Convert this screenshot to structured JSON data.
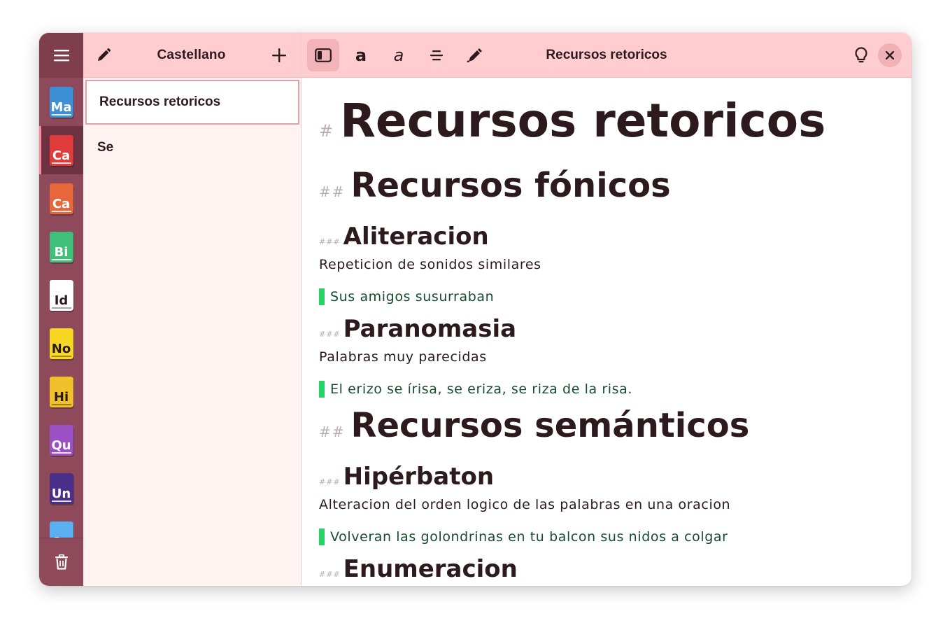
{
  "rail": {
    "notebooks": [
      {
        "abbr": "Ma",
        "color": "#3d8fd6",
        "active": false
      },
      {
        "abbr": "Ca",
        "color": "#e03b3b",
        "active": true
      },
      {
        "abbr": "Ca",
        "color": "#e8673a",
        "active": false
      },
      {
        "abbr": "Bi",
        "color": "#3fbf7a",
        "active": false
      },
      {
        "abbr": "Id",
        "color": "#ffffff",
        "active": false,
        "darkText": true
      },
      {
        "abbr": "No",
        "color": "#f7d724",
        "active": false,
        "darkText": true
      },
      {
        "abbr": "Hi",
        "color": "#f0c12a",
        "active": false,
        "darkText": true
      },
      {
        "abbr": "Qu",
        "color": "#9b4fc4",
        "active": false
      },
      {
        "abbr": "Un",
        "color": "#4a2f8a",
        "active": false
      },
      {
        "abbr": "Oo",
        "color": "#5ab0f0",
        "active": false
      }
    ]
  },
  "notes_panel": {
    "title": "Castellano",
    "items": [
      {
        "label": "Recursos retoricos",
        "selected": true
      },
      {
        "label": "Se",
        "selected": false
      }
    ]
  },
  "editor": {
    "title": "Recursos retoricos",
    "toolbar": {
      "bold_glyph": "a",
      "italic_glyph": "a"
    },
    "content": {
      "h1": {
        "mark": "#",
        "text": "Recursos retoricos"
      },
      "s1": {
        "h2": {
          "mark": "##",
          "text": "Recursos fónicos"
        },
        "a": {
          "mark": "###",
          "title": "Aliteracion",
          "body": "Repeticion de sonidos similares",
          "quote": "Sus amigos susurraban"
        },
        "b": {
          "mark": "###",
          "title": "Paranomasia",
          "body": "Palabras muy parecidas",
          "quote": "El erizo se írisa, se eriza, se riza de la risa."
        }
      },
      "s2": {
        "h2": {
          "mark": "##",
          "text": "Recursos semánticos"
        },
        "a": {
          "mark": "###",
          "title": "Hipérbaton",
          "body": "Alteracion del orden logico de las palabras en una oracion",
          "quote": "Volveran las golondrinas en tu balcon sus nidos a colgar"
        },
        "b": {
          "mark": "###",
          "title": "Enumeracion"
        }
      }
    }
  },
  "colors": {
    "header_pink": "#ffcdd0",
    "rail": "#8e4a5b",
    "quote_bar": "#25d366",
    "quote_text": "#154d2e"
  }
}
